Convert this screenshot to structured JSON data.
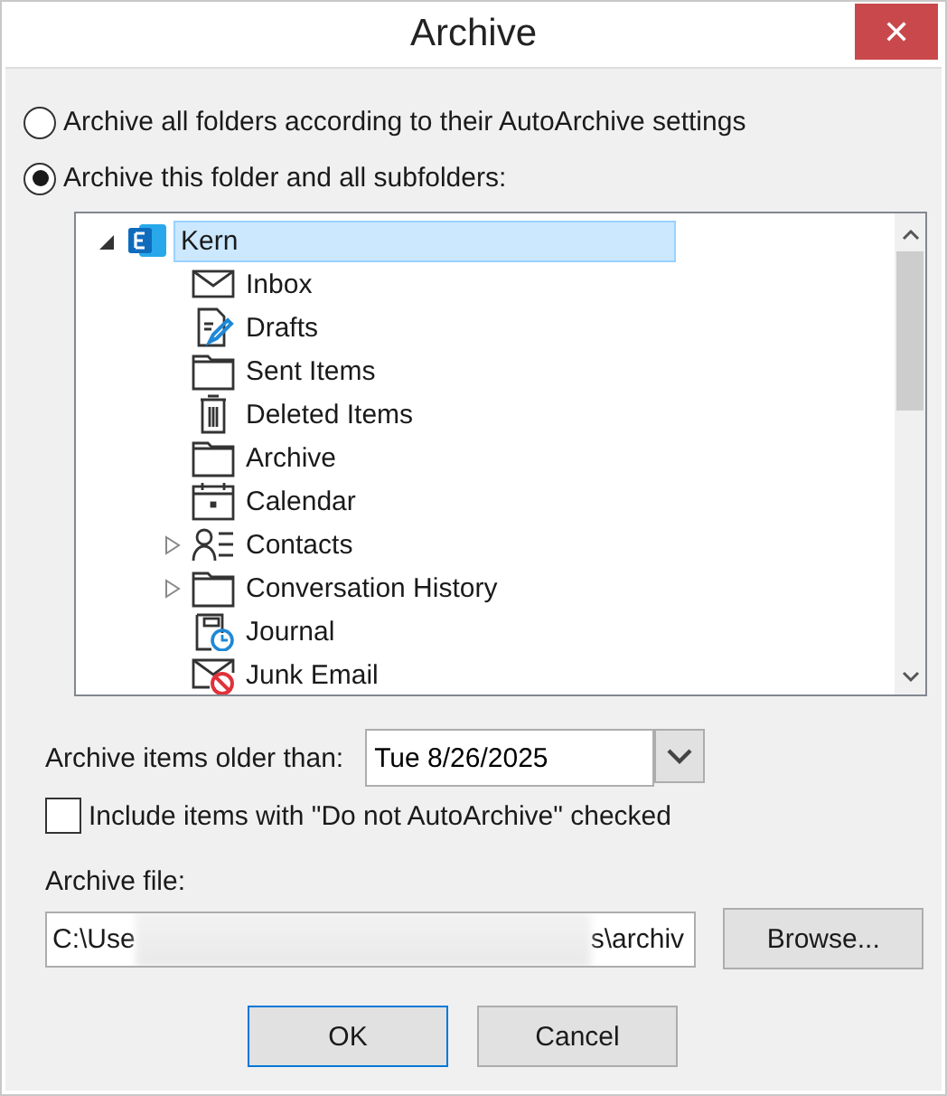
{
  "window": {
    "title": "Archive",
    "close": "✕"
  },
  "options": [
    {
      "label": "Archive all folders according to their AutoArchive settings",
      "selected": false
    },
    {
      "label": "Archive this folder and all subfolders:",
      "selected": true
    }
  ],
  "tree": {
    "root": {
      "label": "Kern",
      "kind": "exchange",
      "expanded": true,
      "selected": true,
      "children": [
        {
          "label": "Inbox",
          "kind": "mail"
        },
        {
          "label": "Drafts",
          "kind": "drafts"
        },
        {
          "label": "Sent Items",
          "kind": "folder"
        },
        {
          "label": "Deleted Items",
          "kind": "trash"
        },
        {
          "label": "Archive",
          "kind": "folder"
        },
        {
          "label": "Calendar",
          "kind": "calendar"
        },
        {
          "label": "Contacts",
          "kind": "contacts",
          "expanded": false
        },
        {
          "label": "Conversation History",
          "kind": "folder",
          "expanded": false
        },
        {
          "label": "Journal",
          "kind": "journal"
        },
        {
          "label": "Junk Email",
          "kind": "junk"
        }
      ]
    }
  },
  "older_than": {
    "label": "Archive items older than:",
    "value": "Tue 8/26/2025"
  },
  "include_checkbox": {
    "label": "Include items with \"Do not AutoArchive\" checked",
    "checked": false
  },
  "archive_file": {
    "label": "Archive file:",
    "value_start": "C:\\Use",
    "value_end": "s\\archiv",
    "browse": "Browse..."
  },
  "buttons": [
    {
      "label": "OK",
      "default": true
    },
    {
      "label": "Cancel",
      "default": false
    }
  ]
}
